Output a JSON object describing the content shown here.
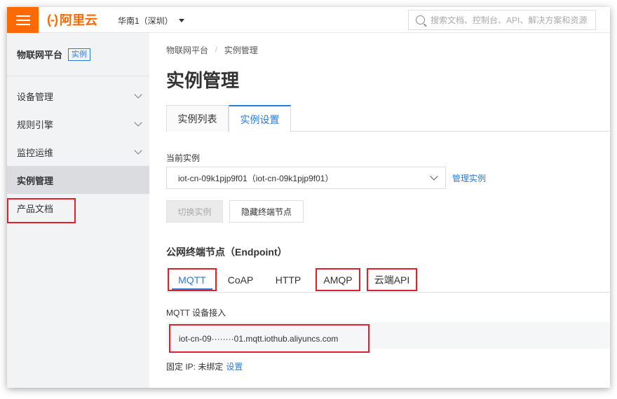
{
  "topbar": {
    "logo_mark": "(-)",
    "logo_text": "阿里云",
    "region": "华南1（深圳）",
    "search_placeholder": "搜索文档、控制台、API、解决方案和资源"
  },
  "sidebar": {
    "title": "物联网平台",
    "badge": "实例",
    "items": [
      {
        "label": "设备管理",
        "expandable": true
      },
      {
        "label": "规则引擎",
        "expandable": true
      },
      {
        "label": "监控运维",
        "expandable": true
      },
      {
        "label": "实例管理",
        "active": true
      },
      {
        "label": "产品文档"
      }
    ]
  },
  "main": {
    "breadcrumb": [
      "物联网平台",
      "实例管理"
    ],
    "breadcrumb_sep": "/",
    "title": "实例管理",
    "tabs": [
      {
        "label": "实例列表"
      },
      {
        "label": "实例设置",
        "active": true
      }
    ],
    "current_instance_label": "当前实例",
    "instance_select_value": "iot-cn-09k1pjp9f01（iot-cn-09k1pjp9f01）",
    "manage_link": "管理实例",
    "switch_button": "切换实例",
    "hide_button": "隐藏终端节点",
    "section_title": "公网终端节点（Endpoint）",
    "protocol_tabs": [
      "MQTT",
      "CoAP",
      "HTTP",
      "AMQP",
      "云端API"
    ],
    "panel_label": "MQTT 设备接入",
    "endpoint": "iot-cn-09········01.mqtt.iothub.aliyuncs.com",
    "fixed_ip_label": "固定 IP: 未绑定",
    "fixed_ip_link": "设置"
  },
  "colors": {
    "brand": "#ff6a00",
    "link": "#2a7bd6",
    "highlight_box": "#e0202a"
  }
}
